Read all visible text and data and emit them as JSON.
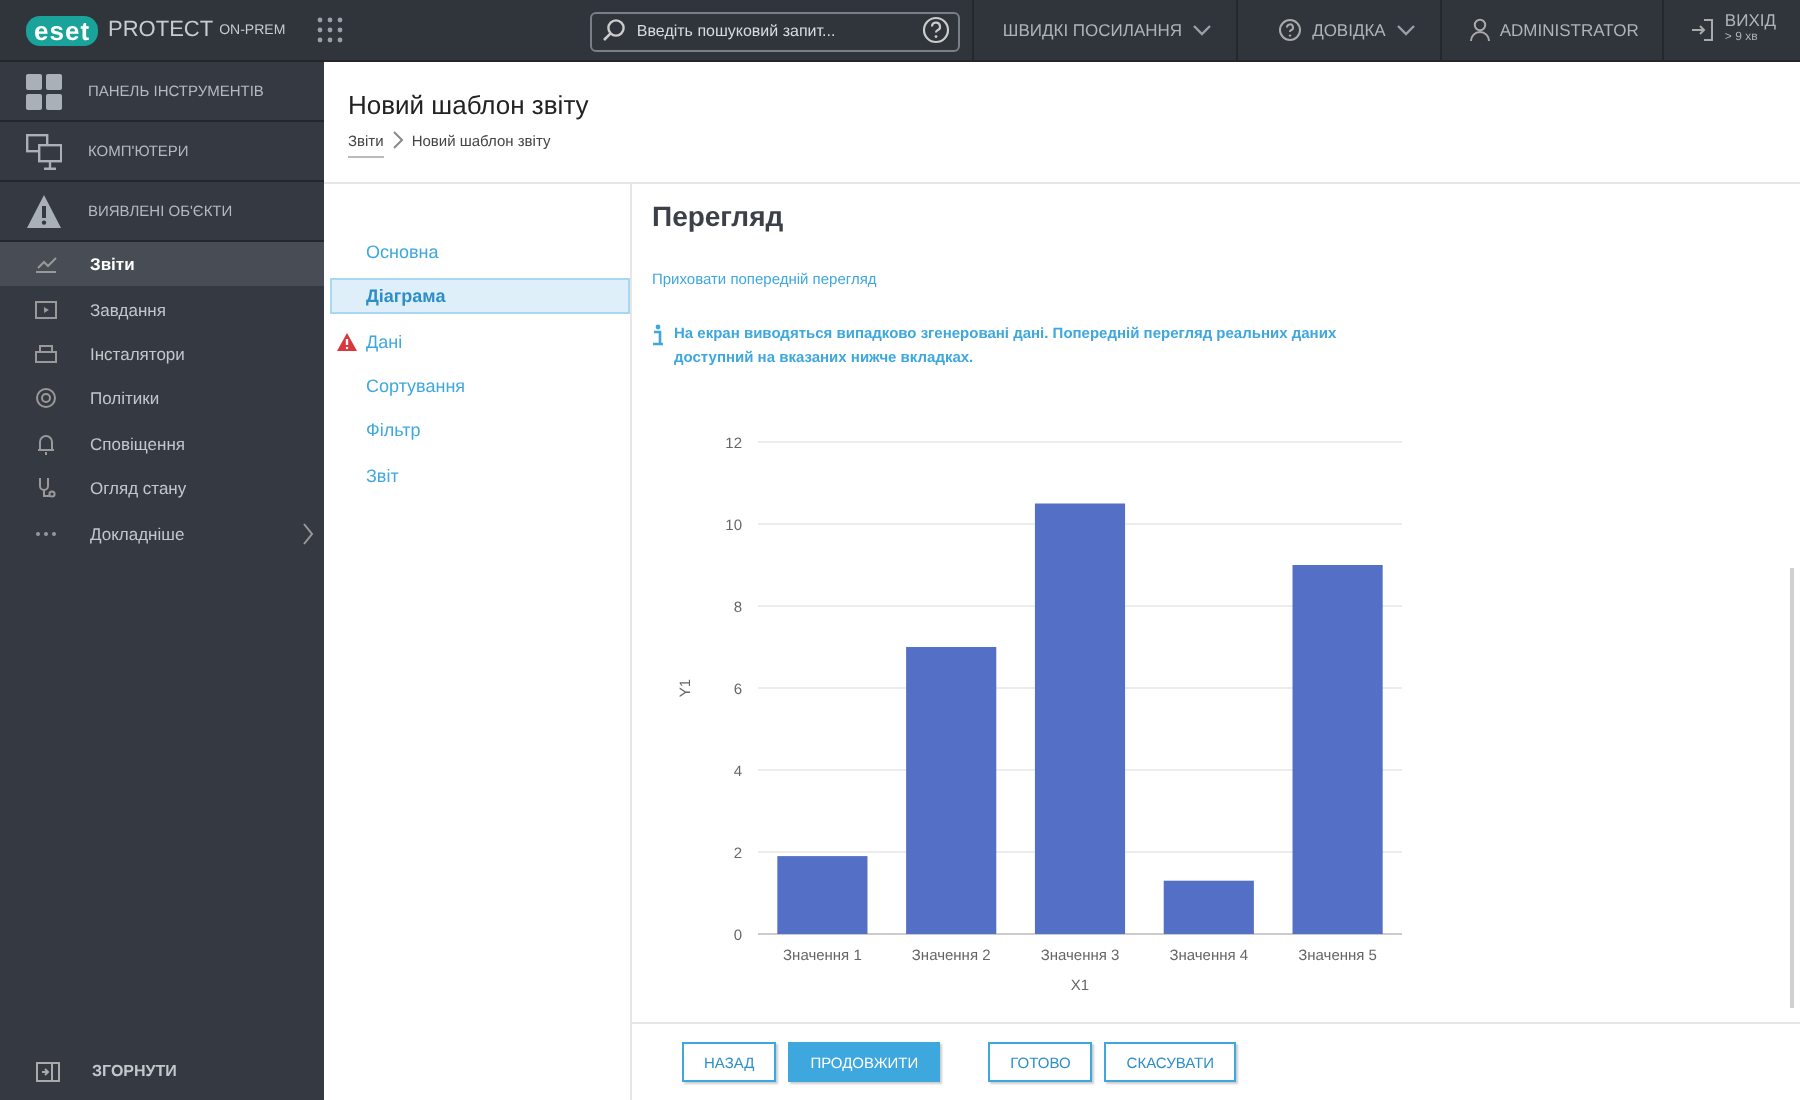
{
  "top_bar": {
    "logo": "eset",
    "product": "PROTECT",
    "edition": "ON-PREM",
    "search": {
      "placeholder": "Введіть пошуковий запит..."
    },
    "menus": [
      {
        "kind": "dropdown",
        "label": "ШВИДКІ ПОСИЛАННЯ"
      },
      {
        "kind": "help",
        "label": "ДОВІДКА"
      },
      {
        "kind": "user",
        "label": "ADMINISTRATOR"
      }
    ],
    "logout": {
      "label": "ВИХІД",
      "note": "> 9 хв"
    }
  },
  "sidebar": {
    "items": [
      {
        "kind": "major",
        "label": "ПАНЕЛЬ ІНСТРУМЕНТІВ",
        "selected": false
      },
      {
        "kind": "major",
        "label": "КОМП'ЮТЕРИ",
        "selected": false
      },
      {
        "kind": "major",
        "label": "ВИЯВЛЕНІ ОБ'ЄКТИ",
        "selected": false
      },
      {
        "kind": "minor",
        "label": "Звіти",
        "selected": true
      },
      {
        "kind": "minor",
        "label": "Завдання",
        "selected": false
      },
      {
        "kind": "minor",
        "label": "Інсталятори",
        "selected": false
      },
      {
        "kind": "minor",
        "label": "Політики",
        "selected": false
      },
      {
        "kind": "minor",
        "label": "Сповіщення",
        "selected": false
      },
      {
        "kind": "minor",
        "label": "Огляд стану",
        "selected": false
      },
      {
        "kind": "more",
        "label": "Докладніше",
        "selected": false
      }
    ],
    "collapse": "ЗГОРНУТИ"
  },
  "page": {
    "title": "Новий шаблон звіту",
    "breadcrumb": [
      "Звіти",
      "Новий шаблон звіту"
    ]
  },
  "wizard": {
    "steps": [
      {
        "label": "Основна",
        "selected": false,
        "warning": false
      },
      {
        "label": "Діаграма",
        "selected": true,
        "warning": false
      },
      {
        "label": "Дані",
        "selected": false,
        "warning": true
      },
      {
        "label": "Сортування",
        "selected": false,
        "warning": false
      },
      {
        "label": "Фільтр",
        "selected": false,
        "warning": false
      },
      {
        "label": "Звіт",
        "selected": false,
        "warning": false
      }
    ]
  },
  "content": {
    "heading": "Перегляд",
    "link": "Приховати попередній перегляд",
    "info": "На екран виводяться випадково згенеровані дані. Попередній перегляд реальних даних доступний на вказаних нижче вкладках.",
    "chart_data": {
      "type": "bar",
      "xlabel": "X1",
      "ylabel": "Y1",
      "categories": [
        "Значення 1",
        "Значення 2",
        "Значення 3",
        "Значення 4",
        "Значення 5"
      ],
      "series": [
        {
          "color": "#5470c6",
          "values": [
            1.9,
            7.0,
            10.5,
            1.3,
            9.0
          ]
        }
      ],
      "grid": true,
      "ylim": [
        0,
        12
      ],
      "yticks": [
        0,
        2,
        4,
        6,
        8,
        10,
        12
      ]
    }
  },
  "footer": {
    "buttons": [
      {
        "kind": "outline",
        "label": "НАЗАД"
      },
      {
        "kind": "primary",
        "label": "ПРОДОВЖИТИ"
      },
      {
        "kind": "outline",
        "label": "ГОТОВО"
      },
      {
        "kind": "outline",
        "label": "СКАСУВАТИ"
      }
    ]
  }
}
